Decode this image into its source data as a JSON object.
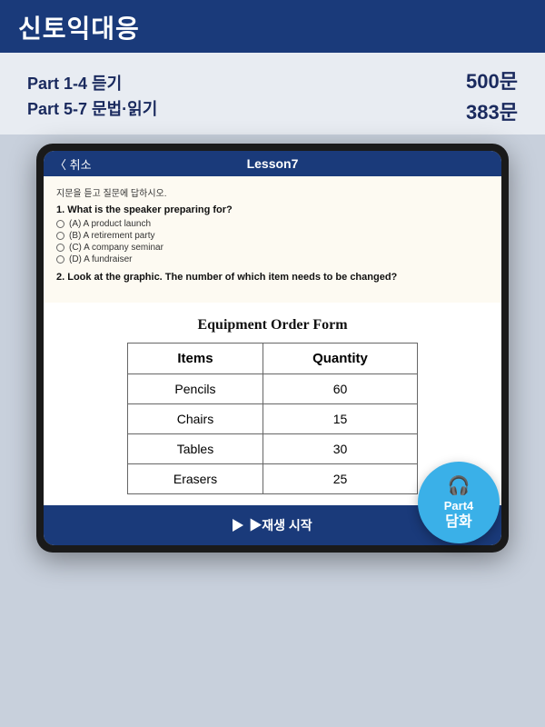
{
  "banner": {
    "title": "신토익대응"
  },
  "info": {
    "line1": "Part 1-4  듣기",
    "line2": "Part 5-7  문법·읽기",
    "count1": "500문",
    "count2": "383문"
  },
  "tablet": {
    "back_label": "〈 취소",
    "lesson_title": "Lesson7",
    "instruction": "지문을 듣고 질문에 답하시오.",
    "q1": "1.  What is the speaker preparing for?",
    "options": [
      "(A) A product launch",
      "(B) A retirement party",
      "(C) A company seminar",
      "(D) A fundraiser"
    ],
    "q2": "2.  Look at the graphic. The number of which item needs to be changed?",
    "table_title": "Equipment Order Form",
    "table_headers": [
      "Items",
      "Quantity"
    ],
    "table_rows": [
      [
        "Pencils",
        "60"
      ],
      [
        "Chairs",
        "15"
      ],
      [
        "Tables",
        "30"
      ],
      [
        "Erasers",
        "25"
      ]
    ],
    "play_button": "▶재생 시작"
  },
  "part4": {
    "label": "Part4",
    "sublabel": "담화"
  }
}
